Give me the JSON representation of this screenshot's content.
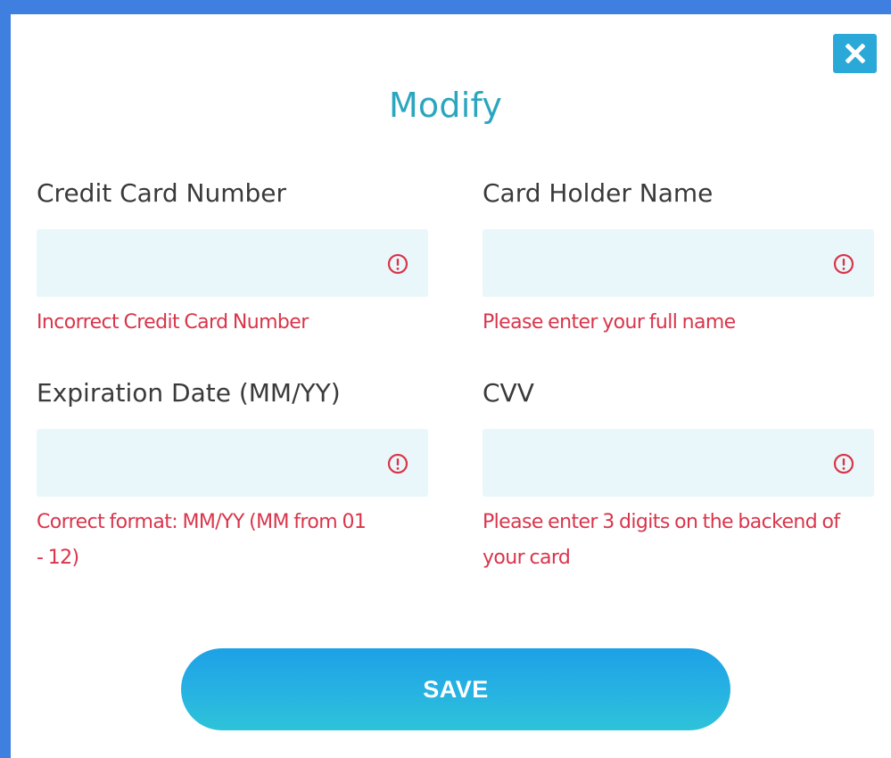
{
  "modal": {
    "title": "Modify",
    "close_icon": "close-icon",
    "save_label": "SAVE"
  },
  "fields": {
    "card_number": {
      "label": "Credit Card Number",
      "value": "",
      "error": "Incorrect Credit Card Number",
      "status_icon": "alert-circle-icon"
    },
    "holder_name": {
      "label": "Card Holder Name",
      "value": "",
      "error": "Please enter your full name",
      "status_icon": "alert-circle-icon"
    },
    "expiration": {
      "label": "Expiration Date (MM/YY)",
      "value": "",
      "error_line1": "Correct format: MM/YY (MM from 01",
      "error_line2": "- 12)",
      "status_icon": "alert-circle-icon"
    },
    "cvv": {
      "label": "CVV",
      "value": "",
      "error_line1": "Please enter 3 digits on the backend of",
      "error_line2": "your card",
      "status_icon": "alert-circle-icon"
    }
  },
  "colors": {
    "frame": "#3f7fdf",
    "title": "#2aa6bf",
    "input_bg": "#eaf7fa",
    "error": "#d9354b",
    "close_bg": "#2aa8d8",
    "save_gradient_top": "#1da1e6",
    "save_gradient_bottom": "#2ec3d8"
  }
}
